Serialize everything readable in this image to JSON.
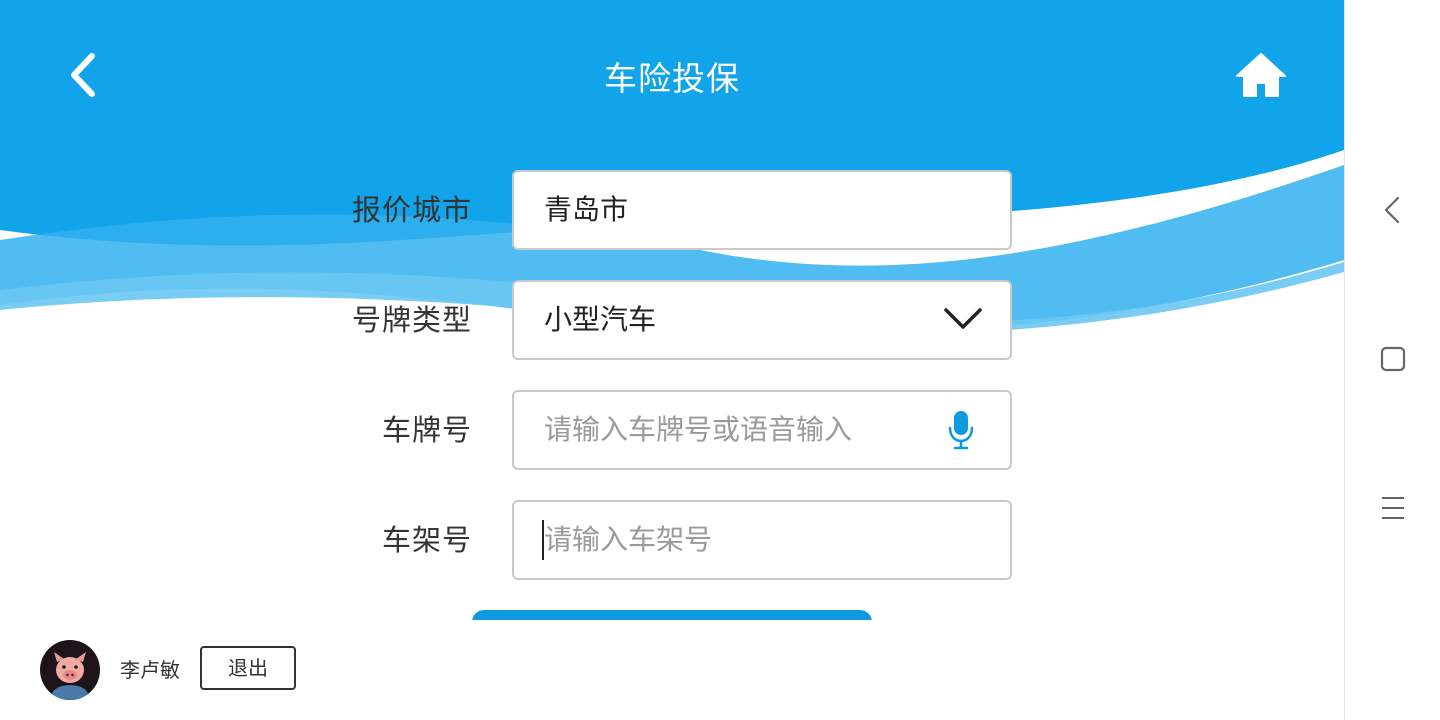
{
  "header": {
    "title": "车险投保",
    "back_icon": "chevron-left-icon",
    "home_icon": "home-icon"
  },
  "form": {
    "city": {
      "label": "报价城市",
      "value": "青岛市"
    },
    "plate_type": {
      "label": "号牌类型",
      "value": "小型汽车",
      "icon": "chevron-down-icon"
    },
    "plate_number": {
      "label": "车牌号",
      "value": "",
      "placeholder": "请输入车牌号或语音输入",
      "icon": "microphone-icon"
    },
    "vin": {
      "label": "车架号",
      "value": "",
      "placeholder": "请输入车架号"
    }
  },
  "footer": {
    "user_name": "李卢敏",
    "logout_label": "退出"
  },
  "colors": {
    "primary": "#0f9ae0",
    "header_bg": "#12a4ea",
    "wave_light": "#6ac6f3"
  },
  "system_nav": {
    "back_icon": "nav-back-icon",
    "home_icon": "nav-home-square-icon",
    "menu_icon": "nav-menu-icon"
  }
}
